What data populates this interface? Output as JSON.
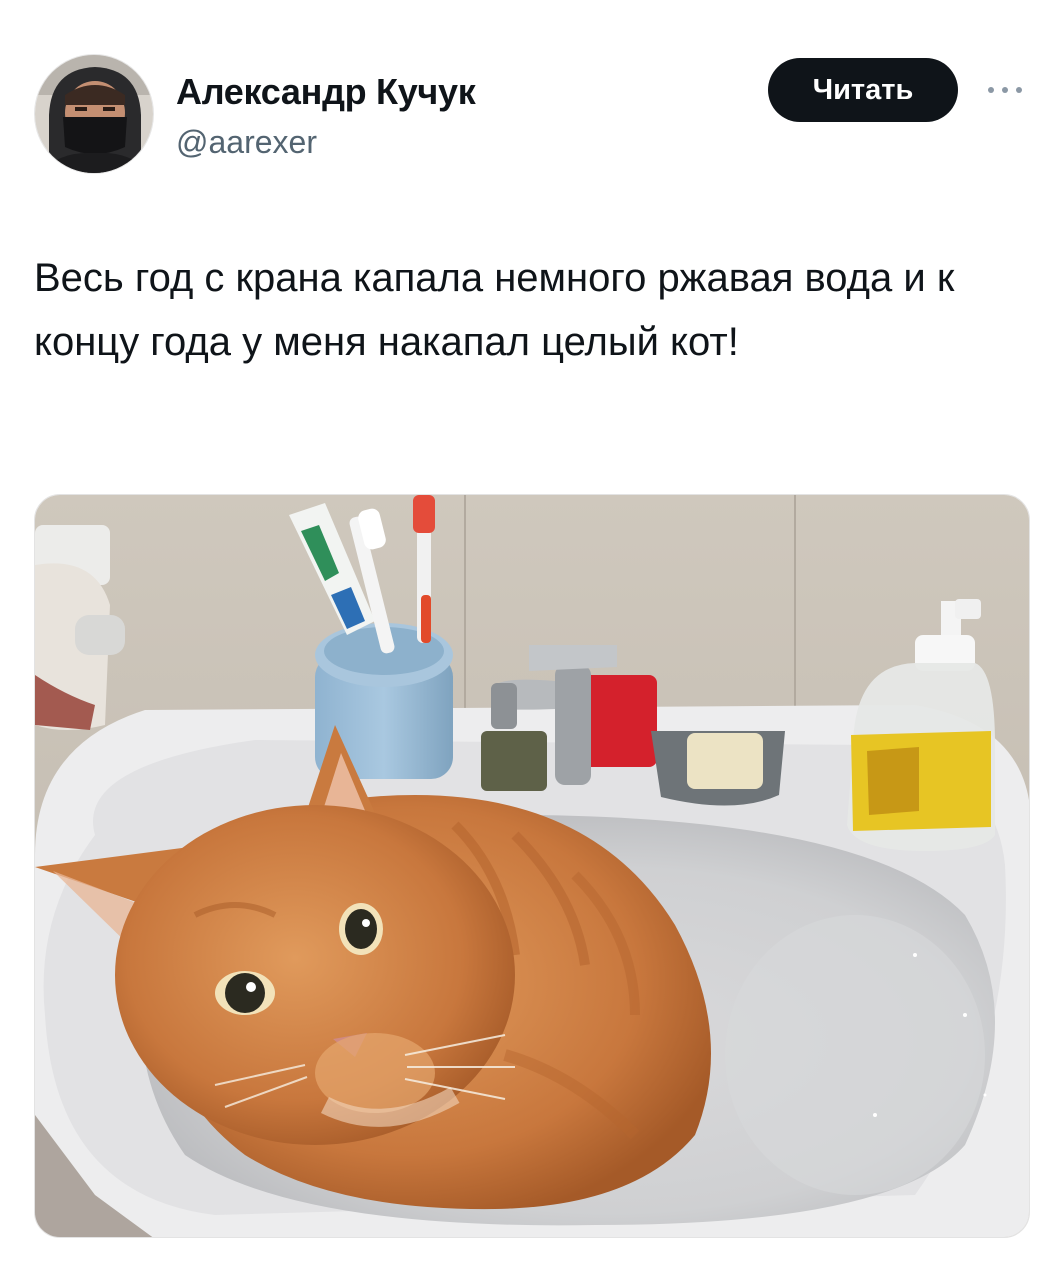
{
  "author": {
    "display_name": "Александр Кучук",
    "handle": "@aarexer",
    "avatar_icon": "user-avatar"
  },
  "actions": {
    "follow_label": "Читать",
    "more_icon": "more-dots-icon"
  },
  "tweet": {
    "text": "Весь год с крана капала немного ржавая вода и к концу года у меня накапал целый кот!"
  },
  "media": {
    "subject": "photo-icon"
  },
  "colors": {
    "text": "#0f1419",
    "secondary": "#536471",
    "button_bg": "#0f1419",
    "button_text": "#ffffff"
  }
}
